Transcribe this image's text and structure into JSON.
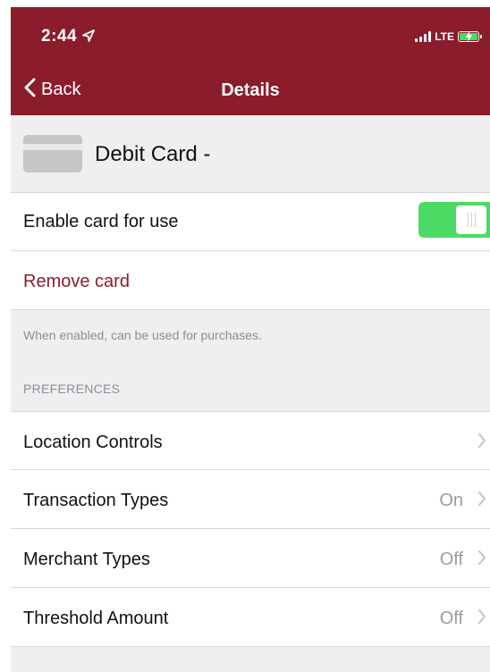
{
  "status_bar": {
    "time": "2:44",
    "network": "LTE"
  },
  "nav": {
    "back_label": "Back",
    "title": "Details"
  },
  "card": {
    "name": "Debit Card -"
  },
  "enable_card": {
    "label": "Enable card for use",
    "enabled": true
  },
  "remove_card": {
    "label": "Remove card"
  },
  "helper_text": "When enabled, can be used for purchases.",
  "preferences": {
    "header": "PREFERENCES",
    "items": [
      {
        "label": "Location Controls",
        "value": ""
      },
      {
        "label": "Transaction Types",
        "value": "On"
      },
      {
        "label": "Merchant Types",
        "value": "Off"
      },
      {
        "label": "Threshold Amount",
        "value": "Off"
      }
    ]
  },
  "colors": {
    "brand": "#8a1c2b",
    "toggle_on": "#4cd964",
    "background": "#efeff1"
  },
  "icons": {
    "location": "location-arrow-icon",
    "back": "chevron-left-icon",
    "row_disclosure": "chevron-right-icon",
    "card": "credit-card-icon"
  }
}
